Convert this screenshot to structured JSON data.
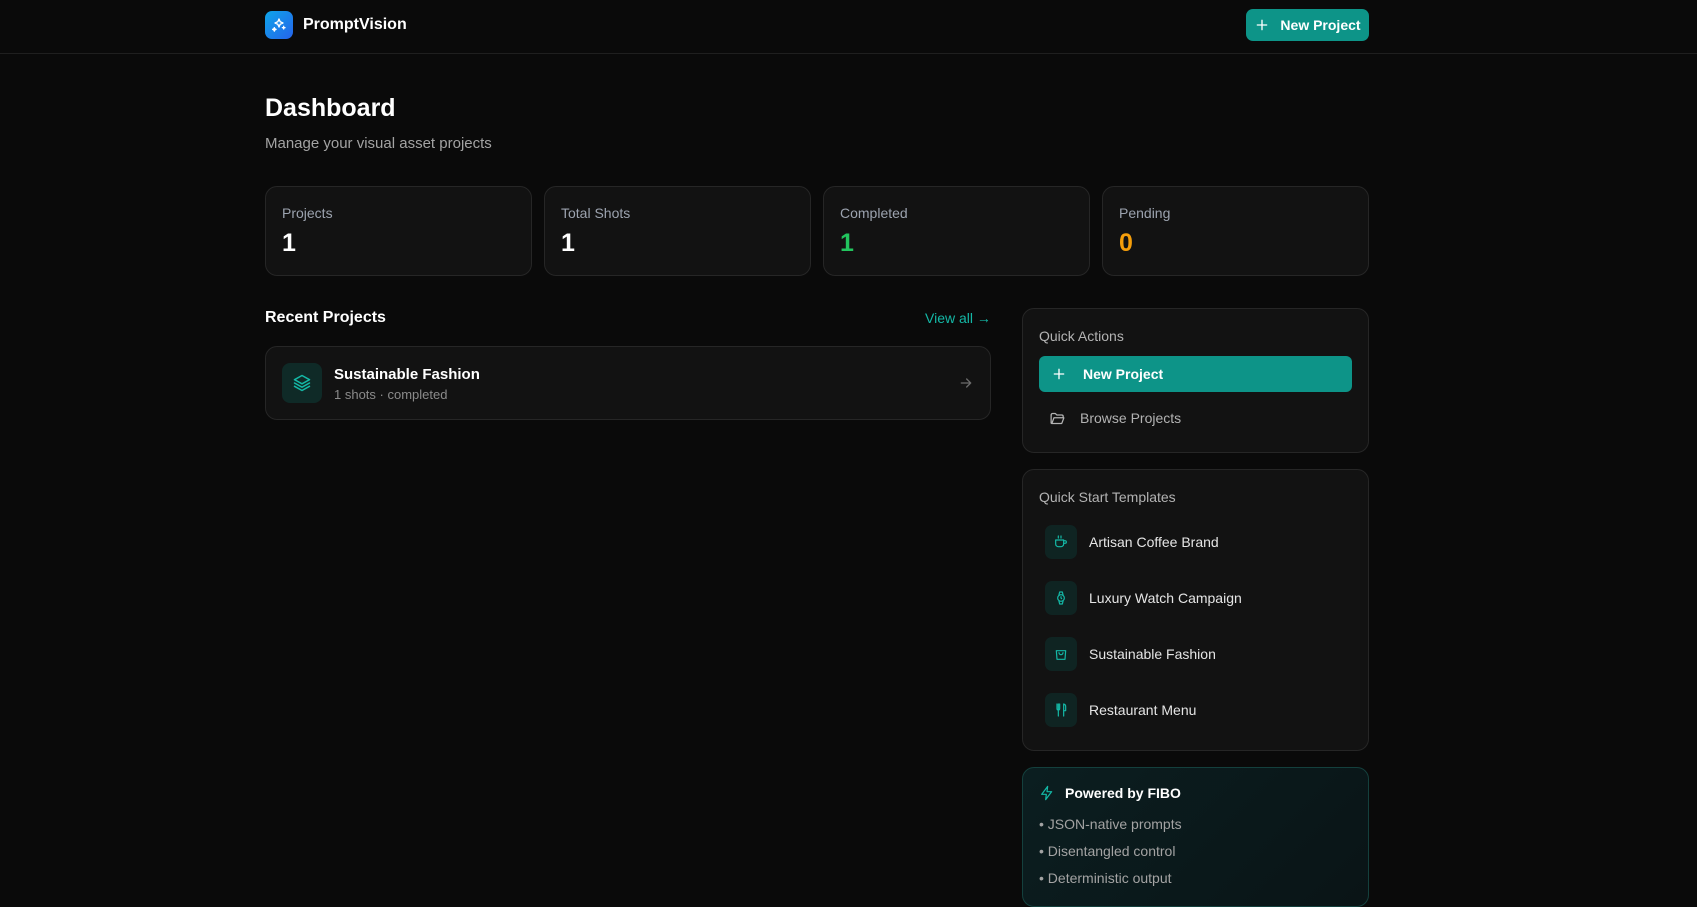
{
  "app": {
    "name": "PromptVision"
  },
  "header": {
    "new_project_label": "New Project"
  },
  "page": {
    "title": "Dashboard",
    "subtitle": "Manage your visual asset projects"
  },
  "stats": [
    {
      "label": "Projects",
      "value": "1",
      "color": "#ffffff"
    },
    {
      "label": "Total Shots",
      "value": "1",
      "color": "#ffffff"
    },
    {
      "label": "Completed",
      "value": "1",
      "color": "#22c55e"
    },
    {
      "label": "Pending",
      "value": "0",
      "color": "#f59e0b"
    }
  ],
  "recent": {
    "title": "Recent Projects",
    "view_all": "View all →",
    "projects": [
      {
        "name": "Sustainable Fashion",
        "meta": "1 shots · completed",
        "icon": "layers-icon"
      }
    ]
  },
  "quick_actions": {
    "title": "Quick Actions",
    "new_project": "New Project",
    "browse_projects": "Browse Projects"
  },
  "templates": {
    "title": "Quick Start Templates",
    "items": [
      {
        "label": "Artisan Coffee Brand",
        "icon": "coffee-icon"
      },
      {
        "label": "Luxury Watch Campaign",
        "icon": "watch-icon"
      },
      {
        "label": "Sustainable Fashion",
        "icon": "shopping-bag-icon"
      },
      {
        "label": "Restaurant Menu",
        "icon": "utensils-icon"
      }
    ]
  },
  "fibo": {
    "title": "Powered by FIBO",
    "lines": [
      "• JSON-native prompts",
      "• Disentangled control",
      "• Deterministic output"
    ]
  },
  "colors": {
    "accent": "#0d9488",
    "accent_text": "#14b8a6",
    "background": "#0a0a0a"
  }
}
